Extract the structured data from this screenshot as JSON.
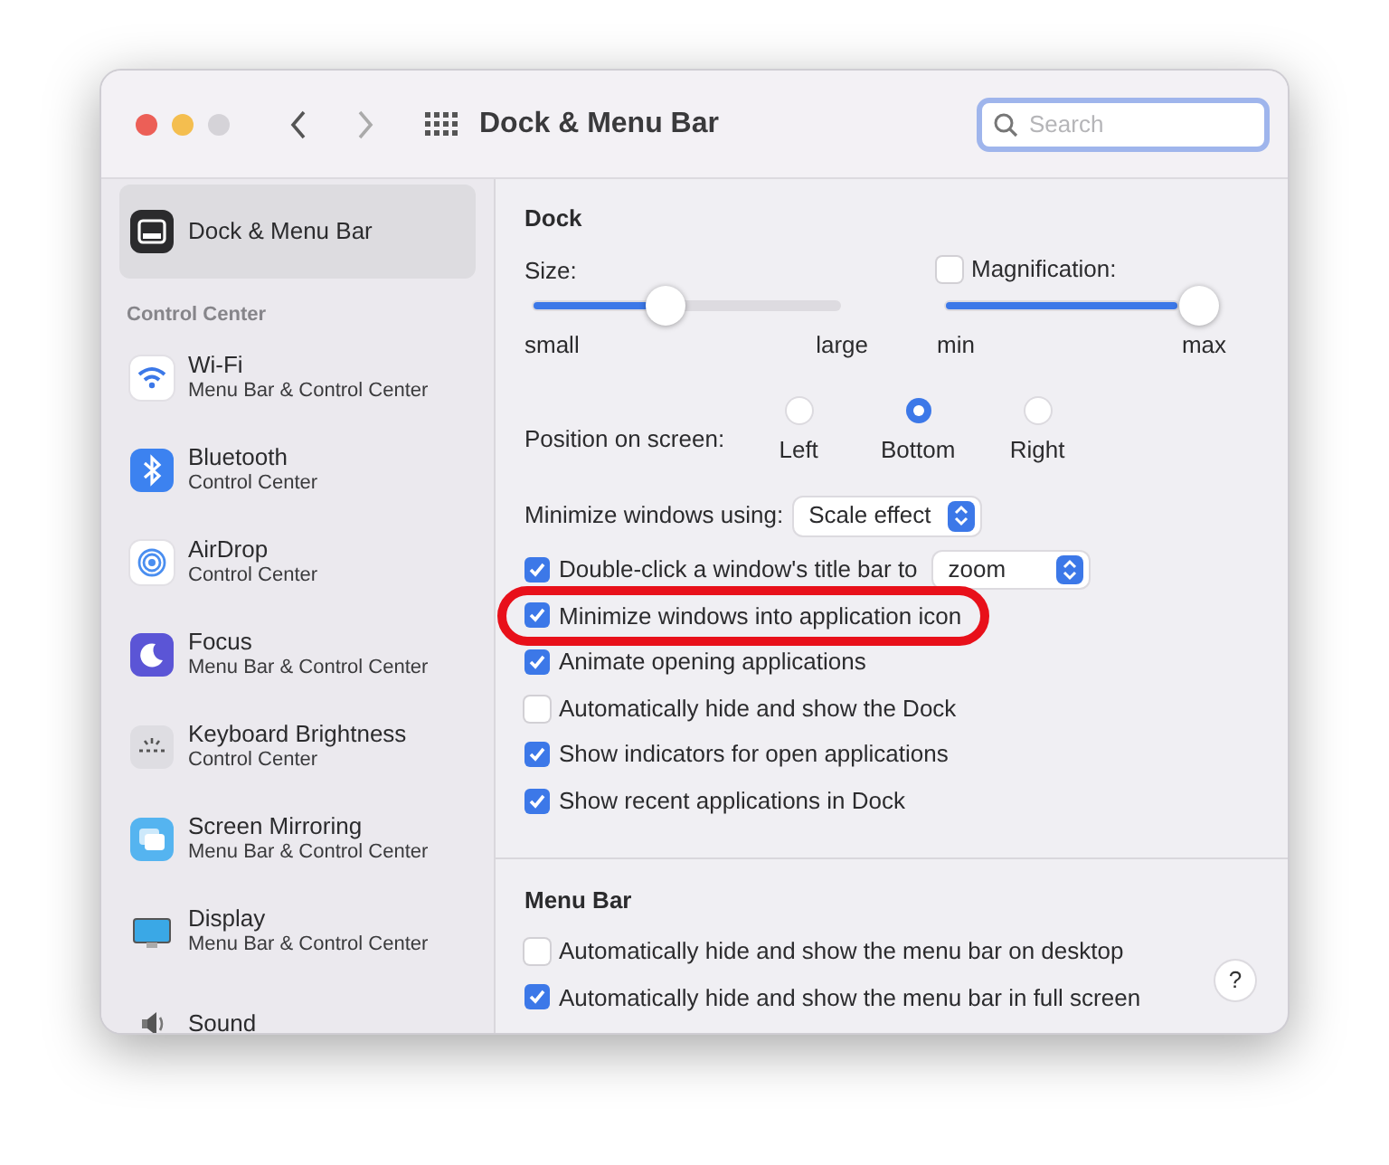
{
  "window": {
    "title": "Dock & Menu Bar"
  },
  "search": {
    "placeholder": "Search"
  },
  "sidebar": {
    "top_item": {
      "label": "Dock & Menu Bar",
      "selected": true,
      "kind": "dock"
    },
    "section": "Control Center",
    "items": [
      {
        "label": "Wi-Fi",
        "subtitle": "Menu Bar & Control Center",
        "kind": "wifi",
        "selected": false
      },
      {
        "label": "Bluetooth",
        "subtitle": "Control Center",
        "kind": "bluetooth",
        "selected": false
      },
      {
        "label": "AirDrop",
        "subtitle": "Control Center",
        "kind": "airdrop",
        "selected": false
      },
      {
        "label": "Focus",
        "subtitle": "Menu Bar & Control Center",
        "kind": "focus",
        "selected": false
      },
      {
        "label": "Keyboard Brightness",
        "subtitle": "Control Center",
        "kind": "keyboard",
        "selected": false
      },
      {
        "label": "Screen Mirroring",
        "subtitle": "Menu Bar & Control Center",
        "kind": "mirroring",
        "selected": false
      },
      {
        "label": "Display",
        "subtitle": "Menu Bar & Control Center",
        "kind": "display",
        "selected": false
      },
      {
        "label": "Sound",
        "kind": "sound",
        "selected": false
      }
    ]
  },
  "dock": {
    "title": "Dock",
    "size": {
      "label": "Size:",
      "level": 0.44,
      "min_label": "small",
      "max_label": "large"
    },
    "magnification": {
      "label": "Magnification:",
      "checked": false,
      "level": 1,
      "min_label": "min",
      "max_label": "max"
    },
    "position": {
      "label": "Position on screen:",
      "options": [
        {
          "label": "Left",
          "selected": false
        },
        {
          "label": "Bottom",
          "selected": true
        },
        {
          "label": "Right",
          "selected": false
        }
      ]
    },
    "minimize_using": {
      "label": "Minimize windows using:",
      "value": "Scale effect"
    },
    "options": [
      {
        "label": "Double-click a window's title bar to",
        "checked": true,
        "popup": "zoom",
        "highlighted": false
      },
      {
        "label": "Minimize windows into application icon",
        "checked": true,
        "highlighted": true
      },
      {
        "label": "Animate opening applications",
        "checked": true,
        "highlighted": false
      },
      {
        "label": "Automatically hide and show the Dock",
        "checked": false,
        "highlighted": false
      },
      {
        "label": "Show indicators for open applications",
        "checked": true,
        "highlighted": false
      },
      {
        "label": "Show recent applications in Dock",
        "checked": true,
        "highlighted": false
      }
    ]
  },
  "menu_bar": {
    "title": "Menu Bar",
    "options": [
      {
        "label": "Automatically hide and show the menu bar on desktop",
        "checked": false
      },
      {
        "label": "Automatically hide and show the menu bar in full screen",
        "checked": true
      }
    ]
  },
  "help_button": {
    "label": "?"
  }
}
